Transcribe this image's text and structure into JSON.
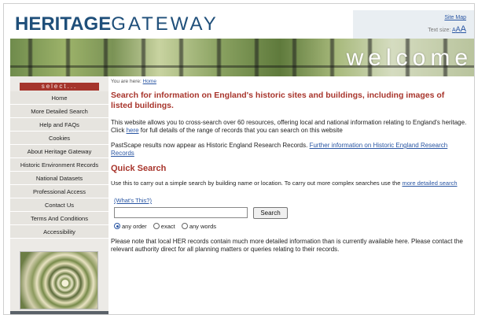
{
  "header": {
    "logo_part1": "HERITAGE",
    "logo_part2": "GATEWAY",
    "site_map": "Site Map",
    "text_size_label": "Text size:",
    "text_size_options": [
      "A",
      "A",
      "A"
    ]
  },
  "banner": {
    "welcome_text": "welcome"
  },
  "sidebar": {
    "header": "select...",
    "items": [
      "Home",
      "More Detailed Search",
      "Help and FAQs",
      "Cookies",
      "About Heritage Gateway",
      "Historic Environment Records",
      "National Datasets",
      "Professional Access",
      "Contact Us",
      "Terms And Conditions",
      "Accessibility"
    ]
  },
  "main": {
    "breadcrumb_prefix": "You are here:",
    "breadcrumb_link": "Home",
    "headline": "Search for information on England's historic sites and buildings, including images of listed buildings.",
    "intro_before": "This website allows you to cross-search over 60 resources, offering local and national information relating to England's heritage. Click ",
    "intro_link": "here",
    "intro_after": " for full details of the range of records that you can search on this website",
    "pastscape_text": "PastScape results now appear as Historic England Research Records. ",
    "pastscape_link": "Further information on Historic England Research Records",
    "quick_search_title": "Quick Search",
    "quick_search_desc": "Use this to carry out a simple search by building name or location. To carry out more complex searches use the ",
    "quick_search_link": "more detailed search",
    "whats_this": "(What's This?)",
    "search_value": "",
    "search_button": "Search",
    "radio_options": [
      "any order",
      "exact",
      "any words"
    ],
    "radio_selected": "any order",
    "note": "Please note that local HER records contain much more detailed information than is currently available here. Please contact the relevant authority direct for all planning matters or queries relating to their records."
  },
  "colors": {
    "brand_blue": "#1f4f7a",
    "accent_red": "#a8352c",
    "link_blue": "#2a56a3"
  }
}
